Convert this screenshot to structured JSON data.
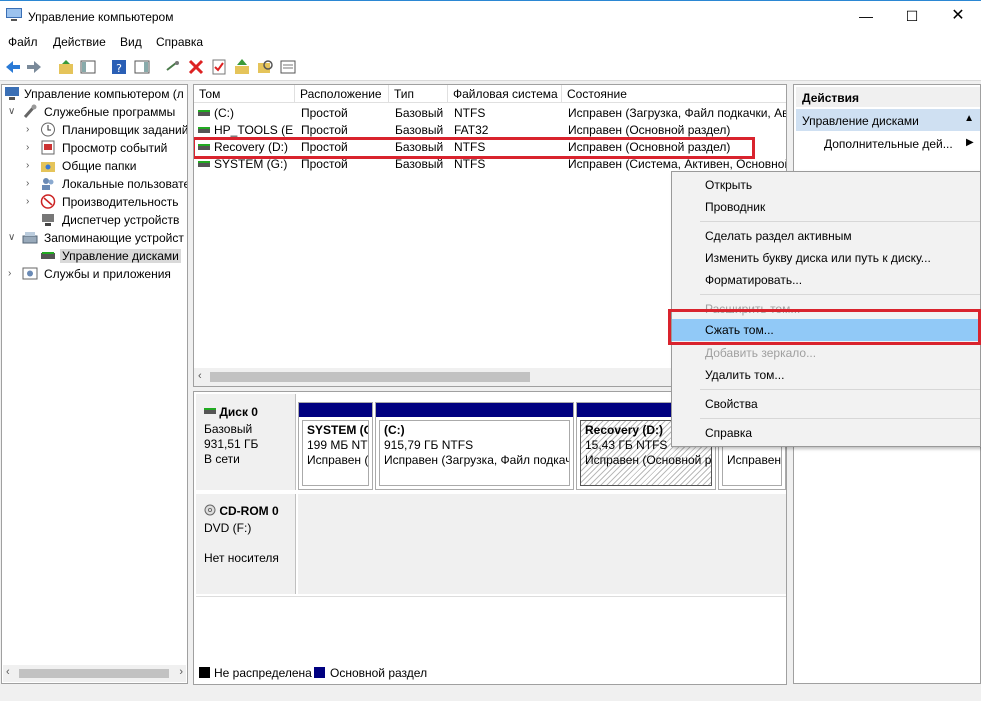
{
  "window": {
    "title": "Управление компьютером"
  },
  "menu": [
    "Файл",
    "Действие",
    "Вид",
    "Справка"
  ],
  "tree": {
    "root": "Управление компьютером (л",
    "items": [
      {
        "label": "Служебные программы",
        "level": 1,
        "expanded": true
      },
      {
        "label": "Планировщик заданий",
        "level": 2,
        "expander": true
      },
      {
        "label": "Просмотр событий",
        "level": 2,
        "expander": true
      },
      {
        "label": "Общие папки",
        "level": 2,
        "expander": true
      },
      {
        "label": "Локальные пользовате",
        "level": 2,
        "expander": true
      },
      {
        "label": "Производительность",
        "level": 2,
        "expander": true
      },
      {
        "label": "Диспетчер устройств",
        "level": 2,
        "expander": false
      },
      {
        "label": "Запоминающие устройст",
        "level": 1,
        "expanded": true
      },
      {
        "label": "Управление дисками",
        "level": 2,
        "selected": true
      },
      {
        "label": "Службы и приложения",
        "level": 1,
        "expander": true
      }
    ]
  },
  "volume_list": {
    "columns": [
      "Том",
      "Расположение",
      "Тип",
      "Файловая система",
      "Состояние"
    ],
    "rows": [
      [
        "(C:)",
        "Простой",
        "Базовый",
        "NTFS",
        "Исправен (Загрузка, Файл подкачки, Ав"
      ],
      [
        "HP_TOOLS (E:)",
        "Простой",
        "Базовый",
        "FAT32",
        "Исправен (Основной раздел)"
      ],
      [
        "Recovery (D:)",
        "Простой",
        "Базовый",
        "NTFS",
        "Исправен (Основной раздел)"
      ],
      [
        "SYSTEM (G:)",
        "Простой",
        "Базовый",
        "NTFS",
        "Исправен (Система, Активен, Основной"
      ]
    ]
  },
  "disks": [
    {
      "name": "Диск 0",
      "type": "Базовый",
      "size": "931,51 ГБ",
      "status": "В сети",
      "partitions": [
        {
          "name": "SYSTEM  (G",
          "size": "199 МБ NTF",
          "status": "Исправен ("
        },
        {
          "name": "(C:)",
          "size": "915,79 ГБ NTFS",
          "status": "Исправен (Загрузка, Файл подкач"
        },
        {
          "name": "Recovery  (D:)",
          "size": "15,43 ГБ NTFS",
          "status": "Исправен (Основной р"
        },
        {
          "name": "",
          "size": "",
          "status": "Исправен"
        }
      ]
    },
    {
      "name": "CD-ROM 0",
      "type": "DVD (F:)",
      "size": "",
      "status": "Нет носителя"
    }
  ],
  "legend": [
    "Не распределена",
    "Основной раздел"
  ],
  "actions": {
    "header": "Действия",
    "section": "Управление дисками",
    "more": "Дополнительные дей..."
  },
  "context_menu": [
    {
      "label": "Открыть",
      "disabled": false
    },
    {
      "label": "Проводник",
      "disabled": false
    },
    {
      "label": "Сделать раздел активным",
      "disabled": false
    },
    {
      "label": "Изменить букву диска или путь к диску...",
      "disabled": false
    },
    {
      "label": "Форматировать...",
      "disabled": false
    },
    {
      "label": "Расширить том...",
      "disabled": true
    },
    {
      "label": "Сжать том...",
      "disabled": false,
      "highlighted": true
    },
    {
      "label": "Добавить зеркало...",
      "disabled": true
    },
    {
      "label": "Удалить том...",
      "disabled": false
    },
    {
      "label": "Свойства",
      "disabled": false
    },
    {
      "label": "Справка",
      "disabled": false
    }
  ],
  "colors": {
    "primary_partition": "#000080",
    "highlight": "#91c9f7",
    "annotation_red": "#d9232d"
  }
}
